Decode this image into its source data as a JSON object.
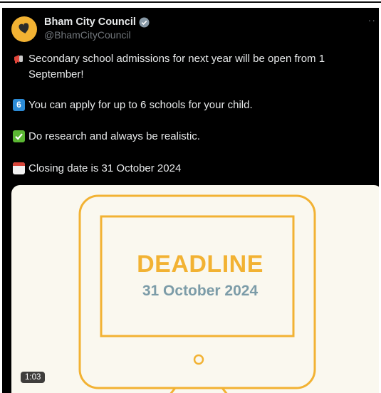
{
  "account": {
    "display_name": "Bham City Council",
    "handle": "@BhamCityCouncil",
    "avatar_color": "#f2b233",
    "verified_icon": "verified-badge-icon"
  },
  "more_icon": "··",
  "tweet_lines": [
    {
      "icon": "megaphone-icon",
      "text": "Secondary school admissions for next year will be open from 1 September!"
    },
    {
      "icon": "keycap-six-icon",
      "icon_text": "6",
      "text": "You can apply for up to 6 schools for your child."
    },
    {
      "icon": "check-mark-icon",
      "text": "Do research and always be realistic."
    },
    {
      "icon": "calendar-icon",
      "text": "Closing date is 31 October 2024"
    }
  ],
  "media": {
    "headline": "DEADLINE",
    "date": "31 October 2024",
    "duration": "1:03",
    "accent_color": "#f2b233",
    "date_color": "#7c9ca8",
    "background": "#faf8ef"
  }
}
